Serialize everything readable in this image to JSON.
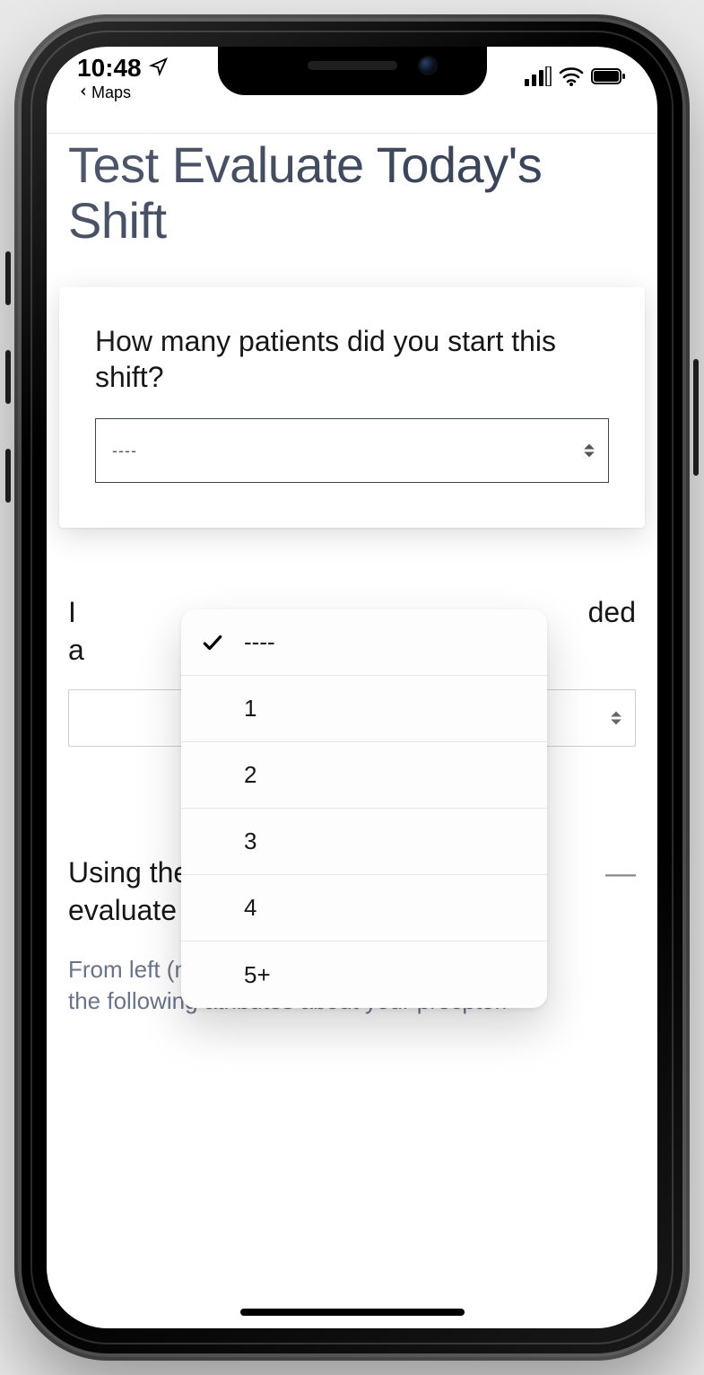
{
  "statusbar": {
    "time": "10:48",
    "back_app": "Maps"
  },
  "page": {
    "title": "Test Evaluate Today's Shift"
  },
  "q1": {
    "label": "How many patients did you start this shift?",
    "selected": "----",
    "options": [
      "----",
      "1",
      "2",
      "3",
      "4",
      "5+"
    ],
    "selected_index": 0
  },
  "q2": {
    "label_visible_fragment_left": "I",
    "label_visible_fragment_right": "ded",
    "label_visible_fragment_bottom": "a",
    "selected": ""
  },
  "q3": {
    "heading": "Using the slider, please evaluate the following:",
    "subtext": "From left (never) to right (always) consider the following atributes about your precptor.",
    "collapse_glyph": "—"
  }
}
